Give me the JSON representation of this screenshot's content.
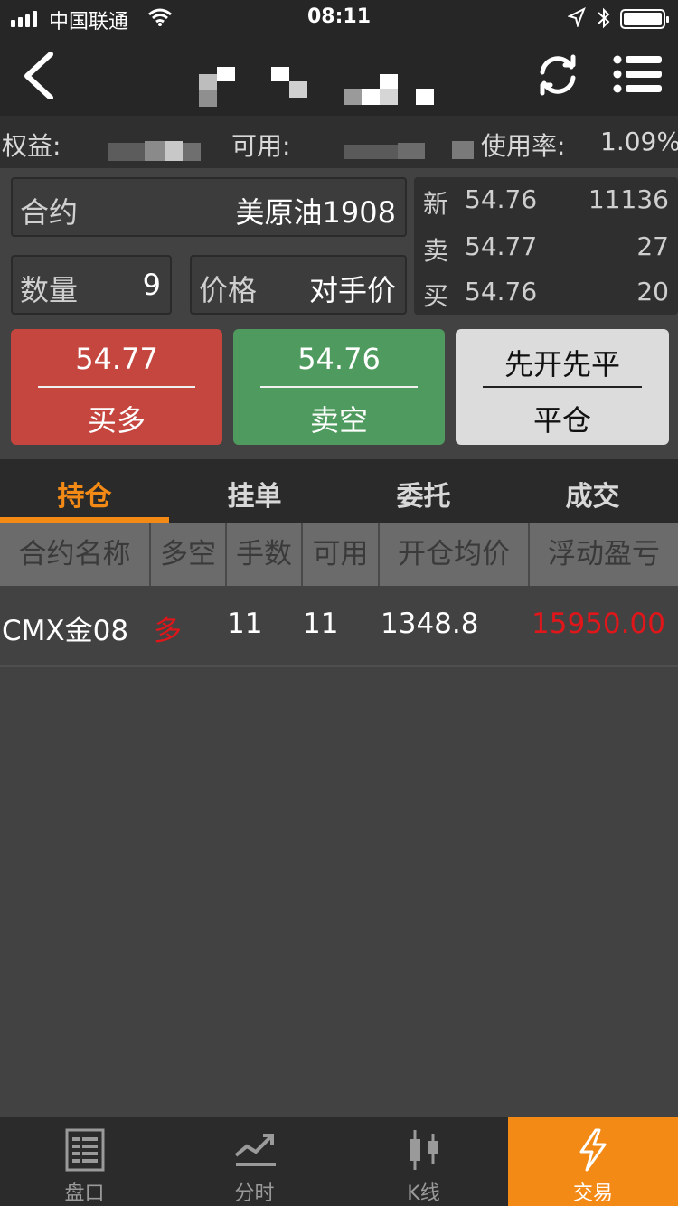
{
  "status_bar": {
    "carrier": "中国联通",
    "time": "08:11"
  },
  "nav": {
    "back_icon": "chevron-left-icon",
    "refresh_icon": "refresh-icon",
    "menu_icon": "list-menu-icon"
  },
  "account": {
    "equity_label": "权益:",
    "available_label": "可用:",
    "usage_label": "使用率:",
    "usage_value": "1.09%"
  },
  "order_form": {
    "contract_label": "合约",
    "contract_value": "美原油1908",
    "quantity_label": "数量",
    "quantity_value": "9",
    "price_label": "价格",
    "price_value": "对手价"
  },
  "quote": {
    "rows": [
      {
        "label": "新",
        "price": "54.76",
        "volume": "11136"
      },
      {
        "label": "卖",
        "price": "54.77",
        "volume": "27"
      },
      {
        "label": "买",
        "price": "54.76",
        "volume": "20"
      }
    ]
  },
  "actions": {
    "buy_price": "54.77",
    "buy_label": "买多",
    "sell_price": "54.76",
    "sell_label": "卖空",
    "close_mode": "先开先平",
    "close_label": "平仓",
    "colors": {
      "buy": "#c4463f",
      "sell": "#4f9b5f",
      "close": "#dcdcdc"
    }
  },
  "tabs": {
    "items": [
      "持仓",
      "挂单",
      "委托",
      "成交"
    ],
    "active_index": 0,
    "accent": "#f38a16"
  },
  "positions": {
    "columns": [
      "合约名称",
      "多空",
      "手数",
      "可用",
      "开仓均价",
      "浮动盈亏"
    ],
    "rows": [
      {
        "name": "CMX金08",
        "direction": "多",
        "lots": "11",
        "available": "11",
        "avg_price": "1348.8",
        "pnl": "15950.00"
      }
    ]
  },
  "bottom_nav": {
    "items": [
      {
        "label": "盘口",
        "icon": "order-book-icon"
      },
      {
        "label": "分时",
        "icon": "intraday-chart-icon"
      },
      {
        "label": "K线",
        "icon": "candlestick-icon"
      },
      {
        "label": "交易",
        "icon": "lightning-icon"
      }
    ],
    "active_index": 3
  }
}
